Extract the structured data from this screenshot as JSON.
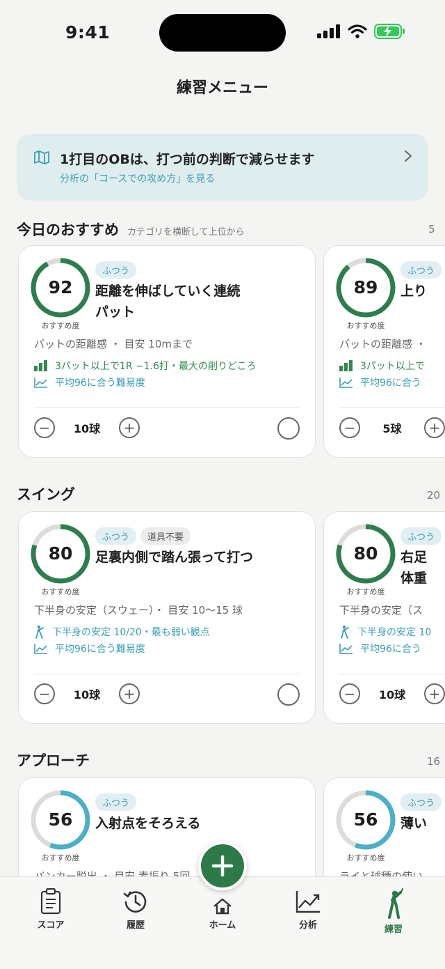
{
  "status_bar": {
    "time": "9:41"
  },
  "page_title": "練習メニュー",
  "banner": {
    "title": "1打目のOBは、打つ前の判断で減らせます",
    "subtitle": "分析の「コースでの攻め方」を見る"
  },
  "sections": [
    {
      "title": "今日のおすすめ",
      "subtitle": "カテゴリを横断して上位から",
      "count": "5",
      "cards": [
        {
          "score": "92",
          "score_label": "おすすめ度",
          "score_pct": 0.92,
          "ring_color": "#2e7d4f",
          "tags": [
            "ふつう"
          ],
          "title": "距離を伸ばしていく連続\nパット",
          "meta": "パットの距離感 ・ 目安 10mまで",
          "insight1": {
            "icon": "bar-chart-icon",
            "text": "3パット以上で1R −1.6打・最大の削りどころ"
          },
          "insight2": {
            "icon": "trend-icon",
            "text": "平均96に合う難易度"
          },
          "ball_count": "10球"
        },
        {
          "score": "89",
          "score_label": "おすすめ度",
          "score_pct": 0.89,
          "ring_color": "#2e7d4f",
          "tags": [
            "ふつう"
          ],
          "title": "上り",
          "meta": "パットの距離感 ・",
          "insight1": {
            "icon": "bar-chart-icon",
            "text": "3パット以上で"
          },
          "insight2": {
            "icon": "trend-icon",
            "text": "平均96に合う"
          },
          "ball_count": "5球"
        }
      ]
    },
    {
      "title": "スイング",
      "subtitle": "",
      "count": "20",
      "cards": [
        {
          "score": "80",
          "score_label": "おすすめ度",
          "score_pct": 0.8,
          "ring_color": "#2e7d4f",
          "tags": [
            "ふつう",
            "道具不要"
          ],
          "title": "足裏内側で踏ん張って打つ",
          "meta": "下半身の安定（スウェー）・ 目安 10〜15 球",
          "insight1": {
            "icon": "golfer-icon",
            "text": "下半身の安定 10/20・最も弱い観点"
          },
          "insight2": {
            "icon": "trend-icon",
            "text": "平均96に合う難易度"
          },
          "ball_count": "10球"
        },
        {
          "score": "80",
          "score_label": "おすすめ度",
          "score_pct": 0.8,
          "ring_color": "#2e7d4f",
          "tags": [
            "ふつう"
          ],
          "title": "右足\n体重",
          "meta": "下半身の安定（ス",
          "insight1": {
            "icon": "golfer-icon",
            "text": "下半身の安定 10"
          },
          "insight2": {
            "icon": "trend-icon",
            "text": "平均96に合う"
          },
          "ball_count": "10球"
        }
      ]
    },
    {
      "title": "アプローチ",
      "subtitle": "",
      "count": "16",
      "cards": [
        {
          "score": "56",
          "score_label": "おすすめ度",
          "score_pct": 0.56,
          "ring_color": "#4bafc7",
          "tags": [
            "ふつう"
          ],
          "title": "入射点をそろえる",
          "meta": "バンカー脱出 ・ 目安 素振り 5回"
        },
        {
          "score": "56",
          "score_label": "おすすめ度",
          "score_pct": 0.56,
          "ring_color": "#4bafc7",
          "tags": [
            "ふつう"
          ],
          "title": "薄い",
          "meta": "ライと球種の使い"
        }
      ]
    }
  ],
  "tabs": [
    {
      "label": "スコア",
      "icon": "clipboard-icon"
    },
    {
      "label": "履歴",
      "icon": "history-icon"
    },
    {
      "label": "ホーム",
      "icon": "home-icon"
    },
    {
      "label": "分析",
      "icon": "chart-icon"
    },
    {
      "label": "練習",
      "icon": "golfer-icon",
      "active": true
    }
  ],
  "colors": {
    "accent": "#2d7a49",
    "info": "#3a9fb5",
    "ring_track": "#dcdcd8"
  }
}
